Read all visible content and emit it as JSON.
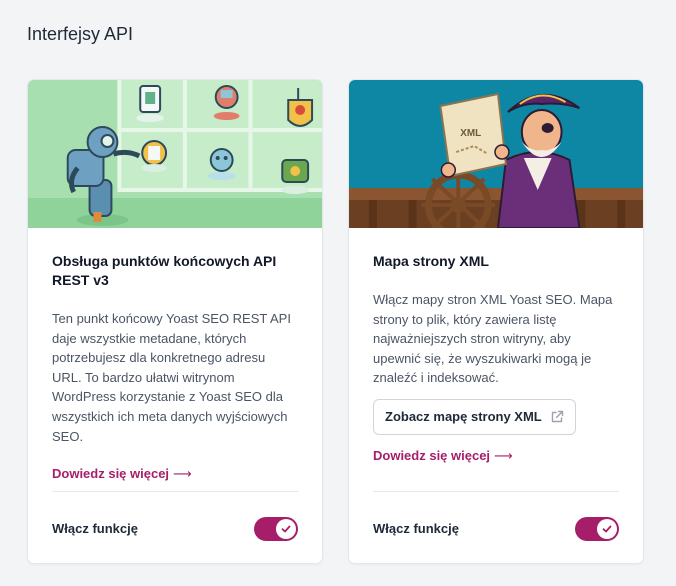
{
  "section": {
    "title": "Interfejsy API"
  },
  "cards": [
    {
      "illustration": "rest-api-robots-illustration",
      "title": "Obsługa punktów końcowych API REST v3",
      "description": "Ten punkt końcowy Yoast SEO REST API daje wszystkie metadane, których potrzebujesz dla konkretnego adresu URL. To bardzo ułatwi witrynom WordPress korzystanie z Yoast SEO dla wszystkich ich meta danych wyjściowych SEO.",
      "learn_more": "Dowiedz się więcej",
      "toggle_label": "Włącz funkcję",
      "toggle_on": true
    },
    {
      "illustration": "xml-sitemap-pirate-illustration",
      "title": "Mapa strony XML",
      "description": "Włącz mapy stron XML Yoast SEO. Mapa strony to plik, który zawiera listę najważniejszych stron witryny, aby upewnić się, że wyszukiwarki mogą je znaleźć i indeksować.",
      "button_label": "Zobacz mapę strony XML",
      "button_icon": "external-link-icon",
      "learn_more": "Dowiedz się więcej",
      "toggle_label": "Włącz funkcję",
      "toggle_on": true
    }
  ],
  "colors": {
    "accent": "#a61e69",
    "page_bg": "#f3f4f6",
    "left_illustration_bg": "#a7dfb0",
    "right_illustration_bg": "#0e87a4"
  }
}
